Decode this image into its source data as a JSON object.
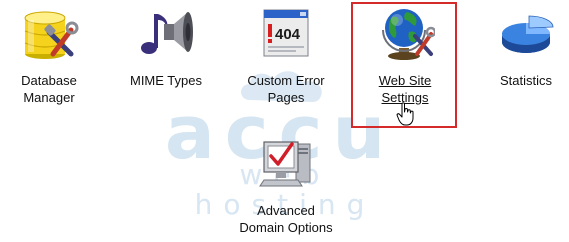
{
  "watermark": {
    "word": "accu",
    "sub": "web hosting"
  },
  "items": [
    {
      "lines": [
        "Database",
        "Manager"
      ],
      "icon": "database-manager-icon",
      "selected": false
    },
    {
      "lines": [
        "MIME Types"
      ],
      "icon": "mime-types-icon",
      "selected": false
    },
    {
      "lines": [
        "Custom Error",
        "Pages"
      ],
      "icon": "custom-error-pages-icon",
      "badge": "404",
      "selected": false
    },
    {
      "lines": [
        "Web Site",
        "Settings"
      ],
      "icon": "web-site-settings-icon",
      "selected": true
    },
    {
      "lines": [
        "Statistics"
      ],
      "icon": "statistics-icon",
      "selected": false
    },
    {
      "lines": [
        "Advanced",
        "Domain Options"
      ],
      "icon": "advanced-domain-options-icon",
      "selected": false
    }
  ],
  "colors": {
    "highlight": "#d42a2a",
    "watermark": "#d5e5f1"
  },
  "cursor": "hand-pointer-icon"
}
